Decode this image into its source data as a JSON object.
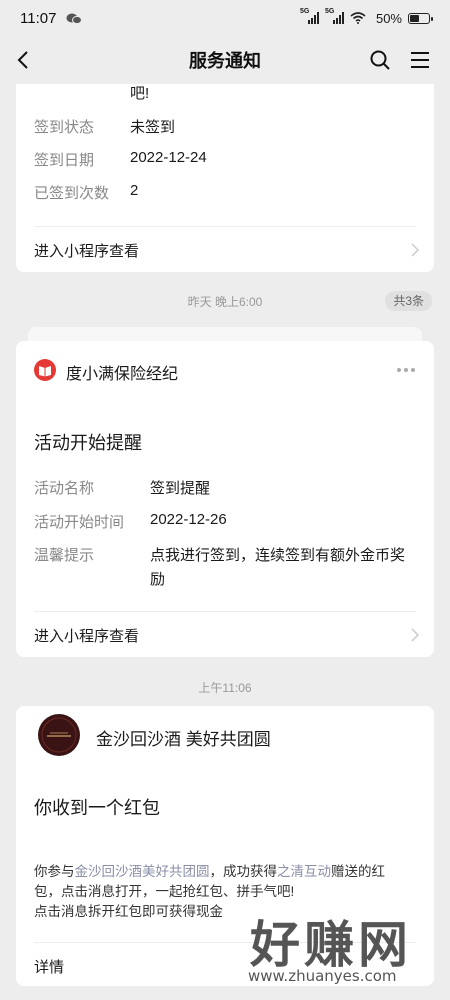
{
  "status_bar": {
    "time": "11:07",
    "network1": "5G",
    "network2": "5G",
    "battery": "50%",
    "battery_level": 0.5
  },
  "nav": {
    "title": "服务通知"
  },
  "card1": {
    "truncated_text": "吧!",
    "rows": [
      {
        "key": "签到状态",
        "value": "未签到"
      },
      {
        "key": "签到日期",
        "value": "2022-12-24"
      },
      {
        "key": "已签到次数",
        "value": "2"
      }
    ],
    "link": "进入小程序查看"
  },
  "timestamp1": "昨天 晚上6:00",
  "badge": "共3条",
  "card2": {
    "app_name": "度小满保险经纪",
    "heading": "活动开始提醒",
    "rows": [
      {
        "key": "活动名称",
        "value": "签到提醒"
      },
      {
        "key": "活动开始时间",
        "value": "2022-12-26"
      },
      {
        "key": "温馨提示",
        "value": "点我进行签到，连续签到有额外金币奖",
        "value2": "励"
      }
    ],
    "link": "进入小程序查看",
    "brand_color": "#e53935"
  },
  "timestamp2": "上午11:06",
  "card3": {
    "app_name": "金沙回沙酒 美好共团圆",
    "heading": "你收到一个红包",
    "body_p1": "你参与",
    "body_link1": "金沙回沙酒美好共团圆",
    "body_p2": "，成功获得",
    "body_link2": "之清互动",
    "body_p3": "赠送的红",
    "body_line2": "包，点击消息打开，一起抢红包、拼手气吧!",
    "body_line3": "点击消息拆开红包即可获得现金",
    "link": "详情",
    "link_color": "#8a8fa8"
  },
  "watermark": {
    "text": "好赚网",
    "url": "www.zhuanyes.com"
  }
}
